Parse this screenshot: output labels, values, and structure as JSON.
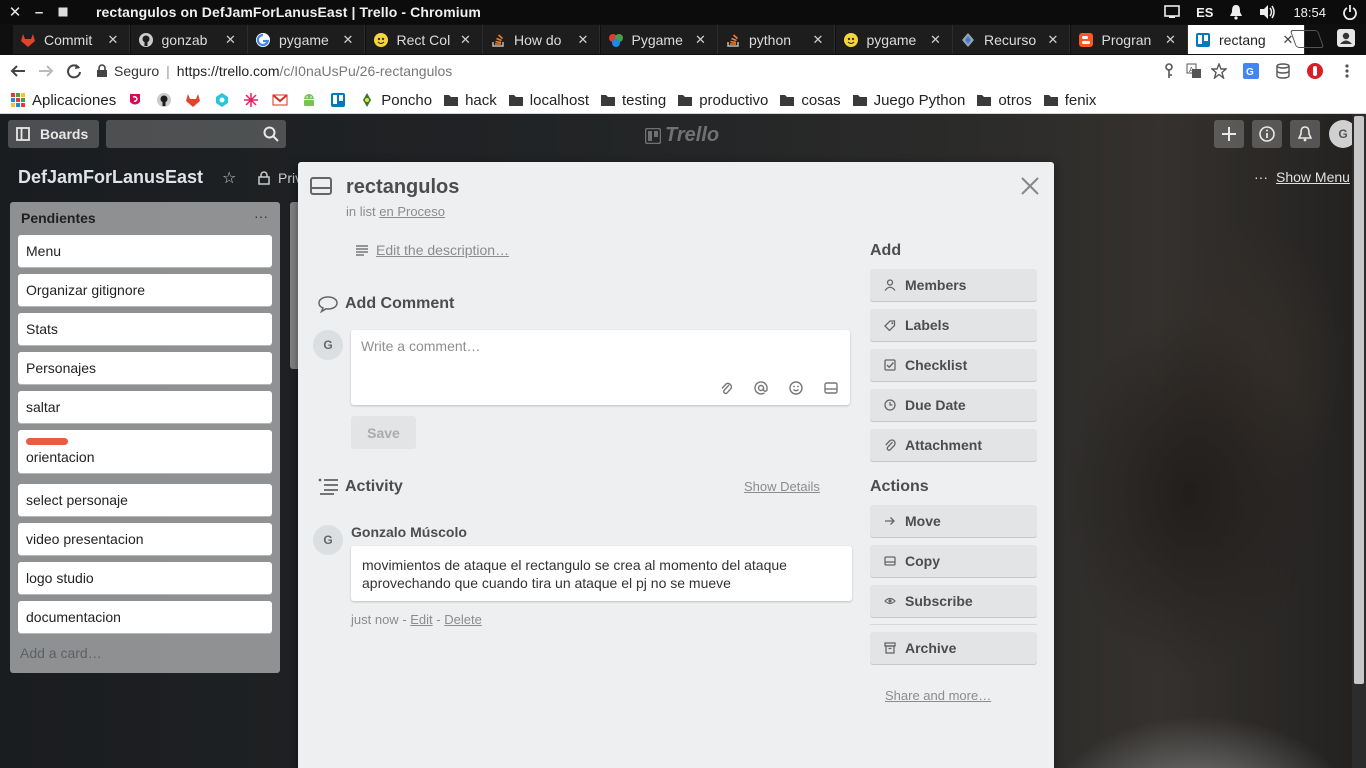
{
  "os": {
    "window_title": "rectangulos on DefJamForLanusEast | Trello - Chromium",
    "language": "ES",
    "clock": "18:54"
  },
  "tabs": [
    {
      "label": "Commit",
      "icon": "gitlab-icon",
      "active": false
    },
    {
      "label": "gonzab",
      "icon": "github-icon",
      "active": false
    },
    {
      "label": "pygame",
      "icon": "google-icon",
      "active": false
    },
    {
      "label": "Rect Col",
      "icon": "pygame-snake-icon",
      "active": false
    },
    {
      "label": "How do",
      "icon": "stackoverflow-icon",
      "active": false
    },
    {
      "label": "Pygame",
      "icon": "pygame-logo-icon",
      "active": false
    },
    {
      "label": "python",
      "icon": "stackoverflow-icon",
      "active": false
    },
    {
      "label": "pygame",
      "icon": "pygame-snake-icon",
      "active": false
    },
    {
      "label": "Recurso",
      "icon": "diamond-icon",
      "active": false
    },
    {
      "label": "Progran",
      "icon": "blogger-icon",
      "active": false
    },
    {
      "label": "rectang",
      "icon": "trello-icon",
      "active": true
    }
  ],
  "address": {
    "secure_label": "Seguro",
    "url_host": "https://trello.com",
    "url_path": "/c/I0naUsPu/26-rectangulos"
  },
  "bookmarks": [
    {
      "label": "Aplicaciones",
      "icon": "apps-grid-icon"
    },
    {
      "label": "",
      "icon": "debian-icon"
    },
    {
      "label": "",
      "icon": "github-icon"
    },
    {
      "label": "",
      "icon": "gitlab-icon"
    },
    {
      "label": "",
      "icon": "python-icon"
    },
    {
      "label": "",
      "icon": "spark-icon"
    },
    {
      "label": "",
      "icon": "gmail-icon"
    },
    {
      "label": "",
      "icon": "android-icon"
    },
    {
      "label": "",
      "icon": "trello-icon"
    },
    {
      "label": "Poncho",
      "icon": "poncho-icon"
    },
    {
      "label": "hack",
      "icon": "folder-icon"
    },
    {
      "label": "localhost",
      "icon": "folder-icon"
    },
    {
      "label": "testing",
      "icon": "folder-icon"
    },
    {
      "label": "productivo",
      "icon": "folder-icon"
    },
    {
      "label": "cosas",
      "icon": "folder-icon"
    },
    {
      "label": "Juego Python",
      "icon": "folder-icon"
    },
    {
      "label": "otros",
      "icon": "folder-icon"
    },
    {
      "label": "fenix",
      "icon": "folder-icon"
    }
  ],
  "trello": {
    "boards_label": "Boards",
    "logo_text": "Trello",
    "avatar_initial": "G",
    "board_title": "DefJamForLanusEast",
    "privacy_label": "Priv",
    "show_menu_label": "Show Menu",
    "list": {
      "title": "Pendientes",
      "cards": [
        {
          "title": "Menu",
          "has_label": false
        },
        {
          "title": "Organizar gitignore",
          "has_label": false
        },
        {
          "title": "Stats",
          "has_label": false
        },
        {
          "title": "Personajes",
          "has_label": false
        },
        {
          "title": "saltar",
          "has_label": false
        },
        {
          "title": "orientacion",
          "has_label": true,
          "label_color": "#eb5a46"
        },
        {
          "title": "select personaje",
          "has_label": false
        },
        {
          "title": "video presentacion",
          "has_label": false
        },
        {
          "title": "logo studio",
          "has_label": false
        },
        {
          "title": "documentacion",
          "has_label": false
        }
      ],
      "add_card": "Add a card…"
    }
  },
  "modal": {
    "title": "rectangulos",
    "in_list_prefix": "in list",
    "in_list_name": "en Proceso",
    "edit_description": "Edit the description…",
    "add_comment_heading": "Add Comment",
    "avatar_initial": "G",
    "comment_placeholder": "Write a comment…",
    "save_label": "Save",
    "activity_heading": "Activity",
    "show_details": "Show Details",
    "activity": {
      "author": "Gonzalo Múscolo",
      "text": "movimientos de ataque el rectangulo se crea al momento del ataque aprovechando que cuando tira un ataque el pj no se mueve",
      "time": "just now",
      "dash1": " - ",
      "edit": "Edit",
      "dash2": " - ",
      "delete": "Delete"
    },
    "sidebar": {
      "add_heading": "Add",
      "add_buttons": [
        {
          "label": "Members",
          "icon": "person-icon"
        },
        {
          "label": "Labels",
          "icon": "tag-icon"
        },
        {
          "label": "Checklist",
          "icon": "checkbox-icon"
        },
        {
          "label": "Due Date",
          "icon": "clock-icon"
        },
        {
          "label": "Attachment",
          "icon": "paperclip-icon"
        }
      ],
      "actions_heading": "Actions",
      "action_buttons": [
        {
          "label": "Move",
          "icon": "arrow-right-icon"
        },
        {
          "label": "Copy",
          "icon": "card-icon"
        },
        {
          "label": "Subscribe",
          "icon": "eye-icon"
        }
      ],
      "archive": {
        "label": "Archive",
        "icon": "archive-icon"
      },
      "share_more": "Share and more…"
    }
  }
}
